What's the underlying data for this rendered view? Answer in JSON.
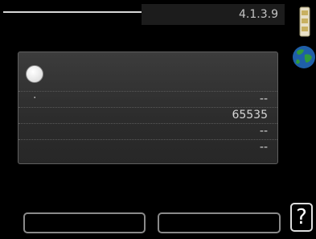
{
  "header": {
    "menu_number": "4.1.3.9",
    "status_icon": "device-icon",
    "globe_icon": "globe-icon"
  },
  "panel": {
    "indicator": "circle-indicator",
    "rows": [
      {
        "label": ".",
        "value": "--"
      },
      {
        "label": "",
        "value": "65535"
      },
      {
        "label": "",
        "value": "--"
      },
      {
        "label": "",
        "value": "--"
      }
    ]
  },
  "footer": {
    "left_button_label": "",
    "right_button_label": "",
    "help_label": "?"
  },
  "colors": {
    "background": "#000000",
    "panel": "#333333",
    "text": "#d6d6d6"
  }
}
